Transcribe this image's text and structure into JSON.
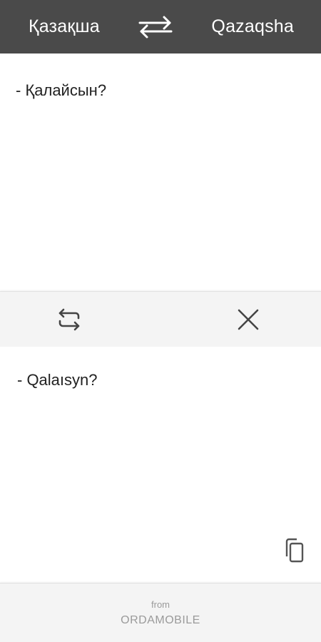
{
  "header": {
    "source_language": "Қазақша",
    "target_language": "Qazaqsha",
    "swap_icon": "swap-arrows-icon"
  },
  "source_panel": {
    "text": "- Қалайсын?"
  },
  "toolbar": {
    "swap_icon": "swap-horizontal-icon",
    "clear_icon": "close-icon"
  },
  "result_panel": {
    "text": "- Qalaısyn?",
    "copy_icon": "copy-icon"
  },
  "footer": {
    "from_label": "from",
    "brand": "ORDAMOBILE"
  },
  "colors": {
    "header_bg": "#4a4a4a",
    "toolbar_bg": "#f4f4f4",
    "text": "#222222",
    "muted": "#9a9a9a"
  }
}
